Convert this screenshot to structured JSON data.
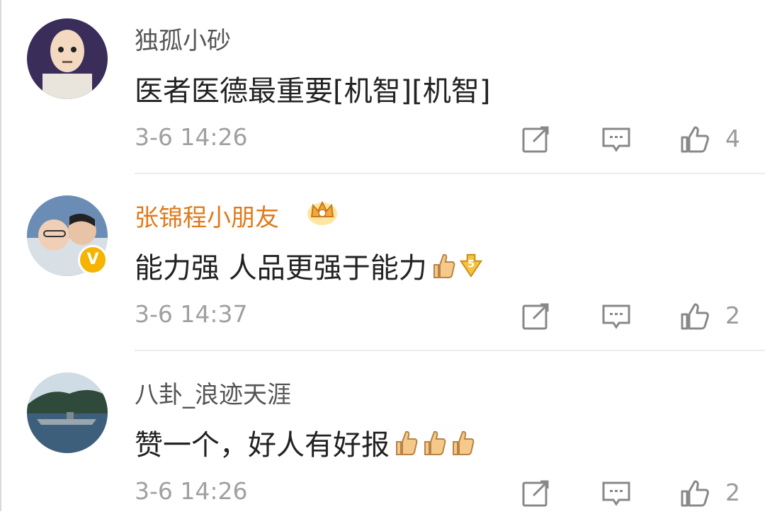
{
  "comments": [
    {
      "username": "独孤小砂",
      "text": "医者医德最重要[机智][机智]",
      "time": "3-6 14:26",
      "likes": "4",
      "vip": false,
      "verified": false,
      "emojis": []
    },
    {
      "username": "张锦程小朋友",
      "text": "能力强 人品更强于能力",
      "time": "3-6 14:37",
      "likes": "2",
      "vip": true,
      "verified": true,
      "emojis": [
        "thumbs-up",
        "five-arrow"
      ]
    },
    {
      "username": "八卦_浪迹天涯",
      "text": "赞一个，好人有好报",
      "time": "3-6 14:26",
      "likes": "2",
      "vip": false,
      "verified": false,
      "emojis": [
        "thumbs-up",
        "thumbs-up",
        "thumbs-up"
      ]
    }
  ],
  "icons": {
    "share": "share-icon",
    "reply": "reply-icon",
    "like": "like-icon",
    "crown": "crown-icon",
    "verified": "verified-icon"
  },
  "colors": {
    "username": "#555555",
    "vip_username": "#e07a1b",
    "meta": "#a0a0a0",
    "text": "#222222"
  }
}
